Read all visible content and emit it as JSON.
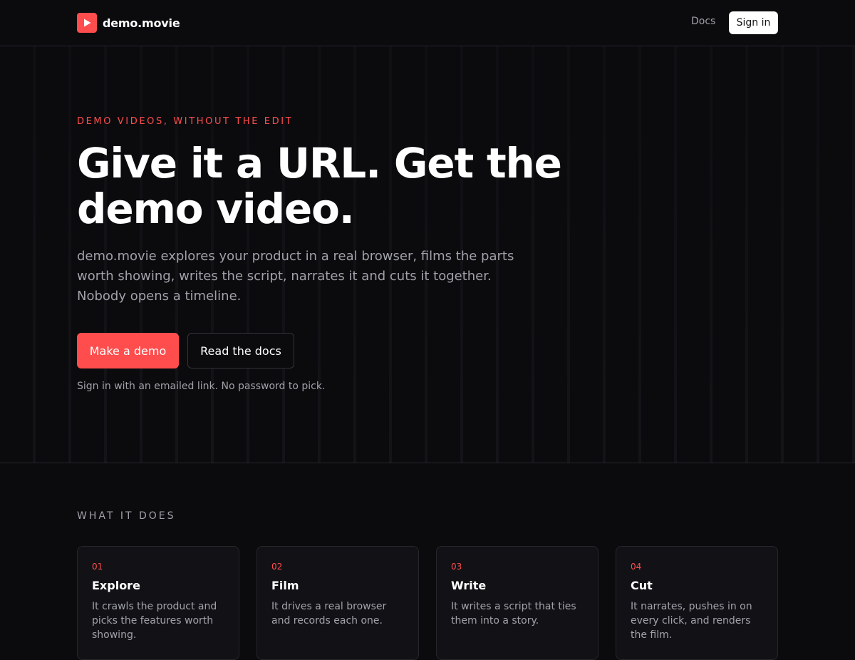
{
  "header": {
    "brand_name": "demo.movie",
    "logo_icon": "play-icon",
    "nav_docs": "Docs",
    "sign_in": "Sign in"
  },
  "hero": {
    "eyebrow": "DEMO VIDEOS, WITHOUT THE EDIT",
    "headline": "Give it a URL. Get the demo video.",
    "lede": "demo.movie explores your product in a real browser, films the parts worth showing, writes the script, narrates it and cuts it together. Nobody opens a timeline.",
    "cta_primary": "Make a demo",
    "cta_secondary": "Read the docs",
    "hint": "Sign in with an emailed link. No password to pick."
  },
  "features": {
    "label": "WHAT IT DOES",
    "items": [
      {
        "num": "01",
        "title": "Explore",
        "desc": "It crawls the product and picks the features worth showing."
      },
      {
        "num": "02",
        "title": "Film",
        "desc": "It drives a real browser and records each one."
      },
      {
        "num": "03",
        "title": "Write",
        "desc": "It writes a script that ties them into a story."
      },
      {
        "num": "04",
        "title": "Cut",
        "desc": "It narrates, pushes in on every click, and renders the film."
      }
    ]
  },
  "colors": {
    "accent": "#ff4d4d",
    "background": "#0b0b0e",
    "muted_text": "#a1a1aa",
    "card_bg": "#121216"
  }
}
